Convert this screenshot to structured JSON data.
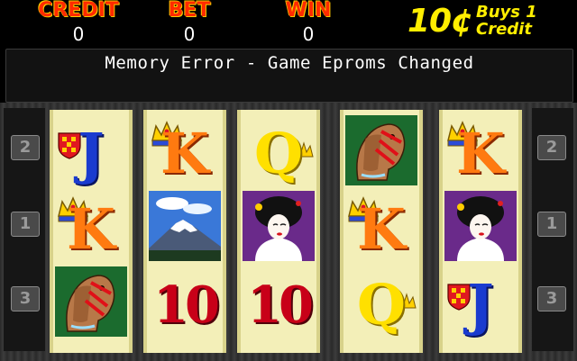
{
  "meters": {
    "credit_label": "CREDIT",
    "credit_value": "0",
    "bet_label": "BET",
    "bet_value": "0",
    "win_label": "WIN",
    "win_value": "0"
  },
  "denomination": {
    "amount": "10¢",
    "line1": "Buys 1",
    "line2": "Credit"
  },
  "message": "Memory Error - Game Eproms Changed",
  "line_indicators": {
    "top": "2",
    "middle": "1",
    "bottom": "3"
  },
  "reels": [
    [
      "jack",
      "king",
      "horse"
    ],
    [
      "king",
      "mount-fuji",
      "ten"
    ],
    [
      "queen",
      "geisha",
      "ten"
    ],
    [
      "horse",
      "king",
      "queen"
    ],
    [
      "king",
      "geisha",
      "jack"
    ]
  ],
  "symbol_glyphs": {
    "jack": "J",
    "king": "K",
    "queen": "Q",
    "ten": "10"
  }
}
